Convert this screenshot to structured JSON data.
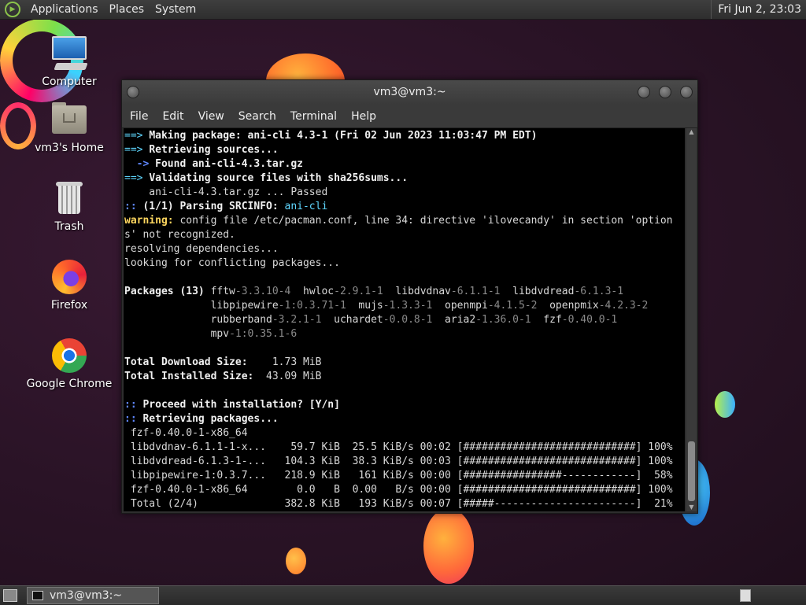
{
  "top_panel": {
    "menus": [
      "Applications",
      "Places",
      "System"
    ],
    "clock": "Fri Jun  2, 23:03"
  },
  "desktop_icons": [
    {
      "label": "Computer",
      "icon": "computer-icon"
    },
    {
      "label": "vm3's Home",
      "icon": "home-folder-icon"
    },
    {
      "label": "Trash",
      "icon": "trash-icon"
    },
    {
      "label": "Firefox",
      "icon": "firefox-icon"
    },
    {
      "label": "Google Chrome",
      "icon": "chrome-icon"
    }
  ],
  "terminal": {
    "title": "vm3@vm3:~",
    "menus": [
      "File",
      "Edit",
      "View",
      "Search",
      "Terminal",
      "Help"
    ],
    "lines": {
      "l1": "Making package: ani-cli 4.3-1 (Fri 02 Jun 2023 11:03:47 PM EDT)",
      "l2": "Retrieving sources...",
      "l3": "Found ani-cli-4.3.tar.gz",
      "l4": "Validating source files with sha256sums...",
      "l5": "    ani-cli-4.3.tar.gz ... Passed",
      "l6a": "(1/1) Parsing SRCINFO: ",
      "l6b": "ani-cli",
      "l7a": "warning:",
      "l7b": " config file /etc/pacman.conf, line 34: directive 'ilovecandy' in section 'option",
      "l8": "s' not recognized.",
      "l9": "resolving dependencies...",
      "l10": "looking for conflicting packages...",
      "pkg_header": "Packages (13) ",
      "pkgs": [
        [
          "fftw",
          "-3.3.10-4",
          "hwloc",
          "-2.9.1-1",
          "libdvdnav",
          "-6.1.1-1",
          "libdvdread",
          "-6.1.3-1"
        ],
        [
          "libpipewire",
          "-1:0.3.71-1",
          "mujs",
          "-1.3.3-1",
          "openmpi",
          "-4.1.5-2",
          "openpmix",
          "-4.2.3-2"
        ],
        [
          "rubberband",
          "-3.2.1-1",
          "uchardet",
          "-0.0.8-1",
          "aria2",
          "-1.36.0-1",
          "fzf",
          "-0.40.0-1"
        ],
        [
          "mpv",
          "-1:0.35.1-6"
        ]
      ],
      "dl_size_label": "Total Download Size:",
      "dl_size_value": "    1.73 MiB",
      "inst_size_label": "Total Installed Size:",
      "inst_size_value": "  43.09 MiB",
      "proceed": "Proceed with installation? [Y/n]",
      "retrieving": "Retrieving packages...",
      "fzf_head": " fzf-0.40.0-1-x86_64",
      "progress": [
        " libdvdnav-6.1.1-1-x...    59.7 KiB  25.5 KiB/s 00:02 [############################] 100%",
        " libdvdread-6.1.3-1-...   104.3 KiB  38.3 KiB/s 00:03 [############################] 100%",
        " libpipewire-1:0.3.7...   218.9 KiB   161 KiB/s 00:00 [################------------]  58%",
        " fzf-0.40.0-1-x86_64        0.0   B  0.00   B/s 00:00 [############################] 100%",
        " Total (2/4)              382.8 KiB   193 KiB/s 00:07 [#####-----------------------]  21%"
      ]
    }
  },
  "taskbar": {
    "task_label": "vm3@vm3:~"
  }
}
